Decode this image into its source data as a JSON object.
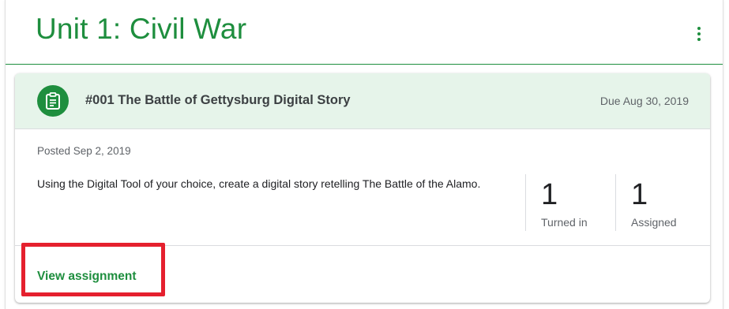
{
  "unit": {
    "title": "Unit 1: Civil War",
    "more_icon": "more-vert-icon"
  },
  "assignment": {
    "icon": "assignment-icon",
    "title": "#001 The Battle of Gettysburg Digital Story",
    "due": "Due Aug 30, 2019",
    "posted": "Posted Sep 2, 2019",
    "description": "Using the Digital Tool of your choice, create a digital story retelling The Battle of the Alamo.",
    "stats": {
      "turned_in": {
        "value": "1",
        "label": "Turned in"
      },
      "assigned": {
        "value": "1",
        "label": "Assigned"
      }
    },
    "view_label": "View assignment"
  },
  "colors": {
    "accent_green": "#1e8e3e",
    "header_bg": "#e6f4ea",
    "highlight_red": "#e5202e"
  }
}
